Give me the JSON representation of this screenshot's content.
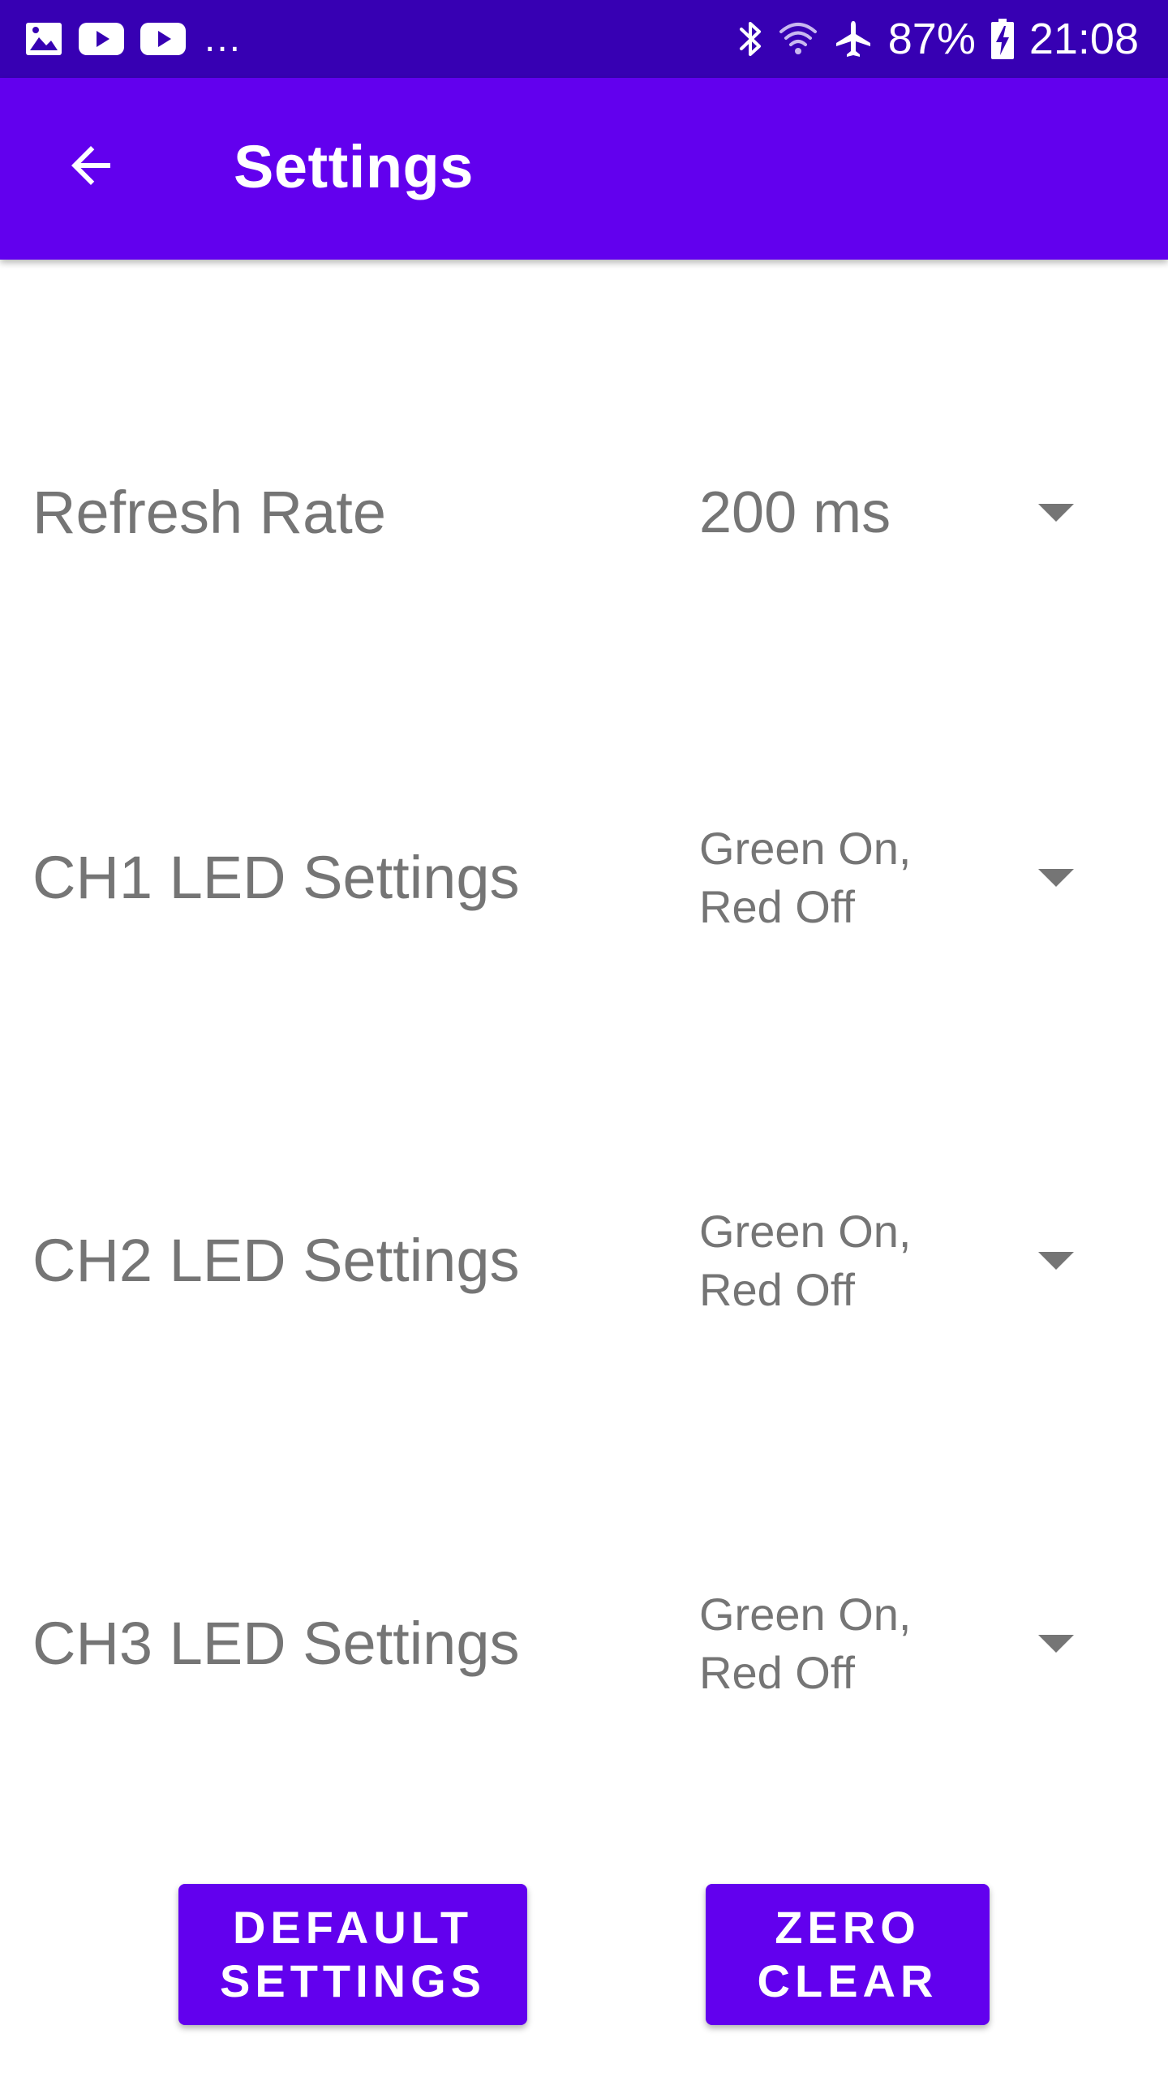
{
  "status_bar": {
    "overflow": "...",
    "battery_percent": "87%",
    "time": "21:08",
    "icons": [
      "image-icon",
      "youtube-icon",
      "youtube-icon",
      "bluetooth-icon",
      "wifi-icon",
      "airplane-mode-icon",
      "battery-charging-icon"
    ]
  },
  "app_bar": {
    "title": "Settings",
    "back_icon": "arrow-back-icon"
  },
  "settings": [
    {
      "label": "Refresh Rate",
      "value": "200 ms"
    },
    {
      "label": "CH1 LED Settings",
      "value": "Green On,\nRed Off"
    },
    {
      "label": "CH2 LED Settings",
      "value": "Green On,\nRed Off"
    },
    {
      "label": "CH3 LED Settings",
      "value": "Green On,\nRed Off"
    }
  ],
  "buttons": {
    "default_settings": "DEFAULT\nSETTINGS",
    "zero_clear": "ZERO\nCLEAR"
  },
  "colors": {
    "status_bar": "#3700b3",
    "primary": "#6200ee",
    "text_secondary": "#757575"
  }
}
